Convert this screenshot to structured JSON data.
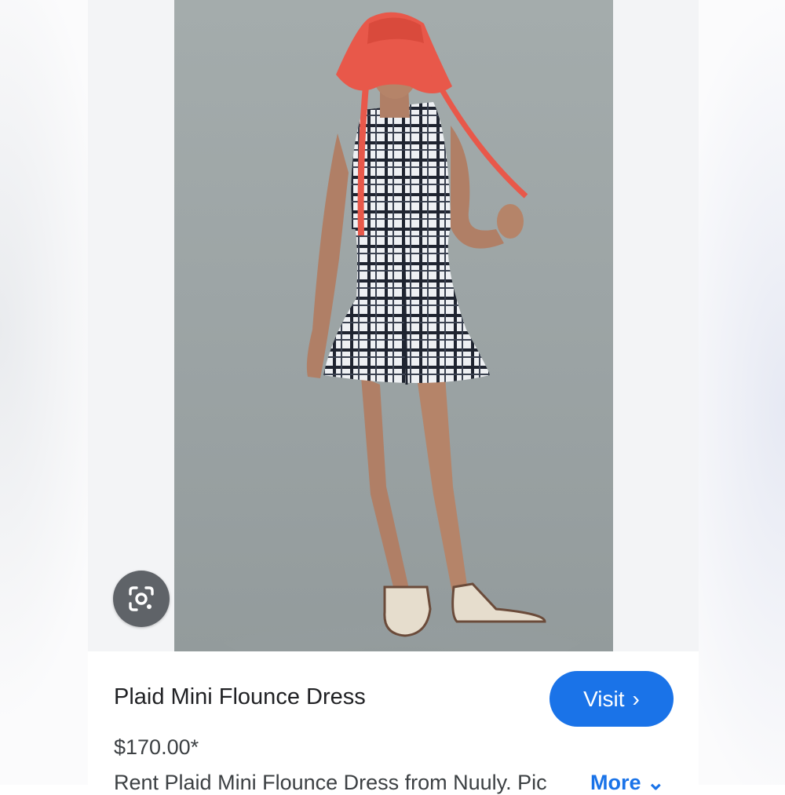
{
  "product": {
    "title": "Plaid Mini Flounce Dress",
    "price": "$170.00*",
    "description": "Rent Plaid Mini Flounce Dress from Nuuly. Pic",
    "more_label": "More",
    "more_icon": "chevron-down-icon"
  },
  "actions": {
    "visit_label": "Visit",
    "visit_icon": "chevron-right-icon",
    "lens_icon": "google-lens-icon"
  },
  "image": {
    "subject": "product-photo"
  },
  "colors": {
    "accent": "#1a73e8",
    "lens_button": "#5f6368",
    "hat": "#e8584a"
  }
}
